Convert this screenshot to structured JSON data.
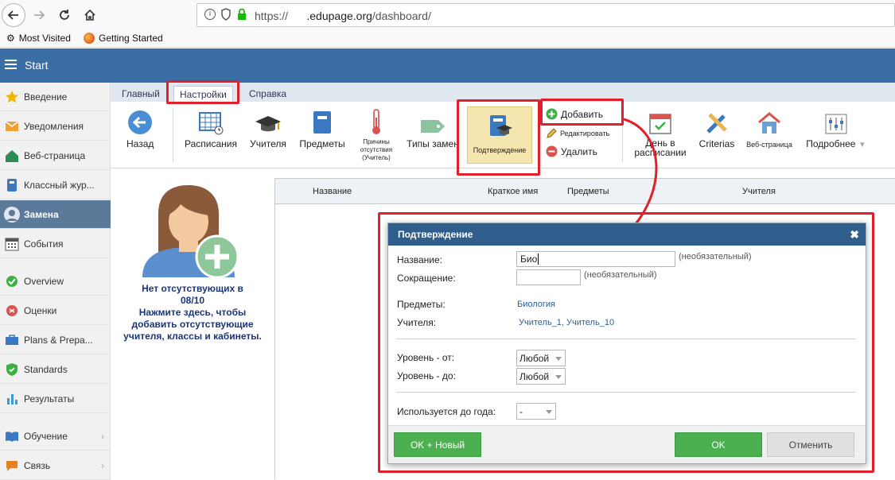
{
  "browser": {
    "url_prefix": "https://",
    "url_domain": ".edupage.org",
    "url_path": "/dashboard/",
    "bookmarks": [
      "Most Visited",
      "Getting Started"
    ]
  },
  "app": {
    "title": "Start"
  },
  "sidebar": {
    "items": [
      {
        "label": "Введение",
        "icon": "star-icon"
      },
      {
        "label": "Уведомления",
        "icon": "envelope-icon"
      },
      {
        "label": "Веб-страница",
        "icon": "house-icon"
      },
      {
        "label": "Классный жур...",
        "icon": "book-icon"
      },
      {
        "label": "Замена",
        "icon": "user-icon"
      },
      {
        "label": "События",
        "icon": "calendar-icon"
      },
      {
        "label": "Overview",
        "icon": "check-icon"
      },
      {
        "label": "Оценки",
        "icon": "grade-icon"
      },
      {
        "label": "Plans & Prepa...",
        "icon": "briefcase-icon"
      },
      {
        "label": "Standards",
        "icon": "shield-icon"
      },
      {
        "label": "Результаты",
        "icon": "bar-chart-icon"
      },
      {
        "label": "Обучение",
        "icon": "open-book-icon"
      },
      {
        "label": "Связь",
        "icon": "chat-icon"
      }
    ]
  },
  "ribbon": {
    "tabs": [
      "Главный",
      "Настройки",
      "Справка"
    ],
    "back": "Назад",
    "schedules": "Расписания",
    "teachers": "Учителя",
    "subjects": "Предметы",
    "absence_reasons": "Причины отсутствия (Учитель)",
    "absence_types": "Типы замен",
    "confirmation": "Подтверждение",
    "add": "Добавить",
    "edit": "Редактировать",
    "delete": "Удалить",
    "day_in_schedule": "День в расписании",
    "criterias": "Criterias",
    "web_page": "Веб-страница",
    "more": "Подробнее"
  },
  "left_panel": {
    "line1": "Нет отсутствующих в",
    "line2": "08/10",
    "line3": "Нажмите здесь, чтобы",
    "line4": "добавить отсутствующие",
    "line5": "учителя, классы и кабинеты."
  },
  "table": {
    "headers": [
      "Название",
      "Краткое имя",
      "Предметы",
      "Учителя"
    ]
  },
  "dialog": {
    "title": "Подтверждение",
    "name_label": "Название:",
    "name_value": "Био",
    "optional": "(необязательный)",
    "abbr_label": "Сокращение:",
    "abbr_value": "",
    "subjects_label": "Предметы:",
    "subjects_value": "Биология",
    "teachers_label": "Учителя:",
    "teachers_value": "Учитель_1, Учитель_10",
    "level_from_label": "Уровень - от:",
    "level_from_value": "Любой",
    "level_to_label": "Уровень - до:",
    "level_to_value": "Любой",
    "used_until_label": "Используется до года:",
    "used_until_value": "-",
    "ok_new": "OK + Новый",
    "ok": "OK",
    "cancel": "Отменить"
  },
  "colors": {
    "header": "#3a6ea5",
    "dialog_title": "#2f5e8d",
    "annotation": "#e0202a",
    "ok_button": "#4caf50"
  }
}
